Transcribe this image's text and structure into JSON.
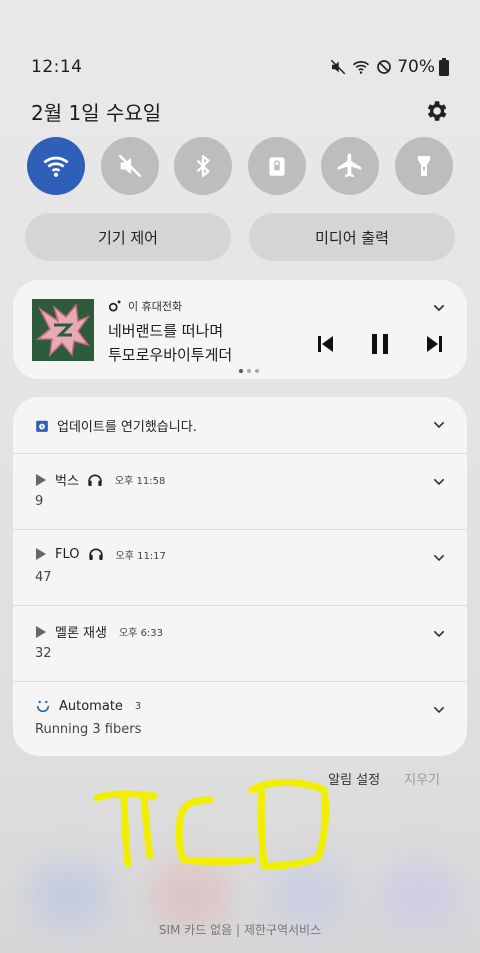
{
  "status_bar": {
    "time": "12:14",
    "battery": "70%",
    "icons": [
      "mute-icon",
      "wifi-icon",
      "no-data-icon",
      "battery-icon"
    ]
  },
  "header": {
    "date": "2월 1일 수요일",
    "icon": "gear-icon"
  },
  "quick_toggles": [
    {
      "name": "wifi",
      "icon": "wifi-icon",
      "active": true
    },
    {
      "name": "sound",
      "icon": "mute-icon",
      "active": false
    },
    {
      "name": "bluetooth",
      "icon": "bluetooth-icon",
      "active": false
    },
    {
      "name": "rotation-lock",
      "icon": "lock-icon",
      "active": false
    },
    {
      "name": "airplane",
      "icon": "airplane-icon",
      "active": false
    },
    {
      "name": "flashlight",
      "icon": "flashlight-icon",
      "active": false
    }
  ],
  "pills": {
    "device_control": "기기 제어",
    "media_output": "미디어 출력"
  },
  "media": {
    "source": "이 휴대전화",
    "title_line1": "네버랜드를 떠나며",
    "title_line2": "투모로우바이투게더",
    "album_art_text": "TOMORROW X TOGETHER",
    "page_dots": 3,
    "active_dot": 0
  },
  "notifications": [
    {
      "app": "업데이트를 연기했습니다.",
      "time": "",
      "detail": "",
      "icon": "calendar-icon"
    },
    {
      "app": "벅스",
      "time": "오후 11:58",
      "detail": "9",
      "icon": "play-icon",
      "headphones": true
    },
    {
      "app": "FLO",
      "time": "오후 11:17",
      "detail": "47",
      "icon": "play-icon",
      "headphones": true
    },
    {
      "app": "멜론 재생",
      "time": "오후 6:33",
      "detail": "32",
      "icon": "play-icon",
      "headphones": false
    },
    {
      "app": "Automate",
      "time": "3",
      "detail": "Running 3 fibers",
      "icon": "smile-icon",
      "headphones": false
    }
  ],
  "actions": {
    "settings": "알림 설정",
    "clear": "지우기"
  },
  "carrier": "SIM 카드 없음 | 제한구역서비스",
  "colors": {
    "accent_blue": "#2f5fb8",
    "highlighter_yellow": "#f2ee00"
  }
}
